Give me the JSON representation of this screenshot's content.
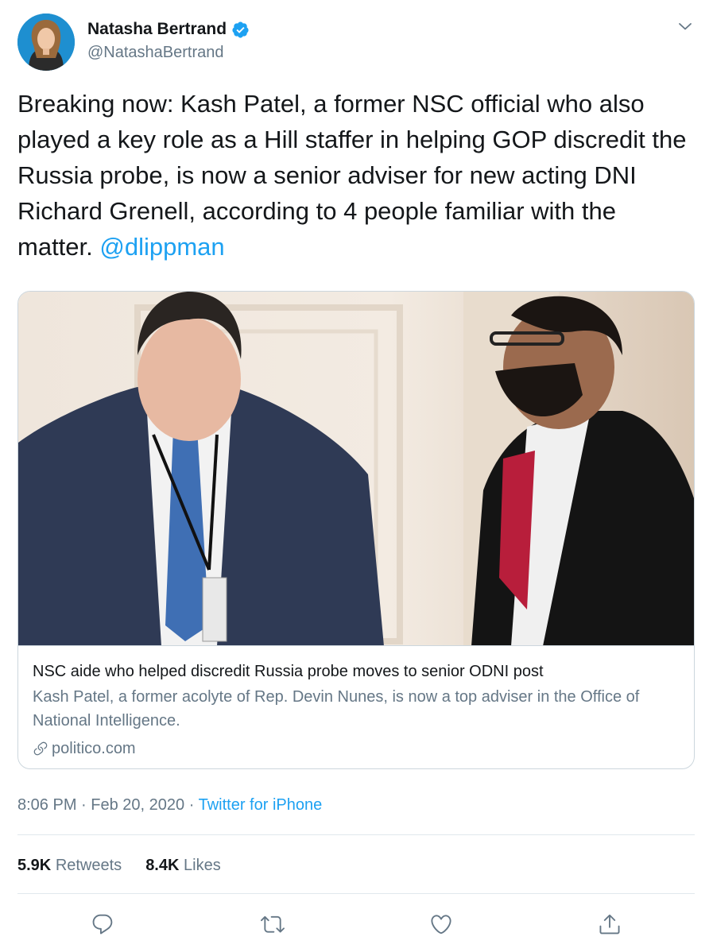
{
  "user": {
    "display_name": "Natasha Bertrand",
    "handle": "@NatashaBertrand",
    "verified": true,
    "avatar_icon": "profile-photo-avatar"
  },
  "tweet": {
    "text": "Breaking now: Kash Patel, a former NSC official who also played a key role as a Hill staffer in helping GOP discredit the Russia probe, is now a senior adviser for new acting DNI Richard Grenell, according to 4 people familiar with the matter.",
    "mention": "@dlippman"
  },
  "card": {
    "image_icon": "photo-two-men-in-suits",
    "title": "NSC aide who helped discredit Russia probe moves to senior ODNI post",
    "description": "Kash Patel, a former acolyte of Rep. Devin Nunes, is now a top adviser in the Office of National Intelligence.",
    "domain": "politico.com"
  },
  "meta": {
    "time": "8:06 PM",
    "separator": "·",
    "date": "Feb 20, 2020",
    "source": "Twitter for iPhone"
  },
  "stats": {
    "retweets_count": "5.9K",
    "retweets_label": "Retweets",
    "likes_count": "8.4K",
    "likes_label": "Likes"
  },
  "colors": {
    "accent": "#1da1f2",
    "secondary_text": "#657786",
    "border": "#ccd6dd"
  }
}
